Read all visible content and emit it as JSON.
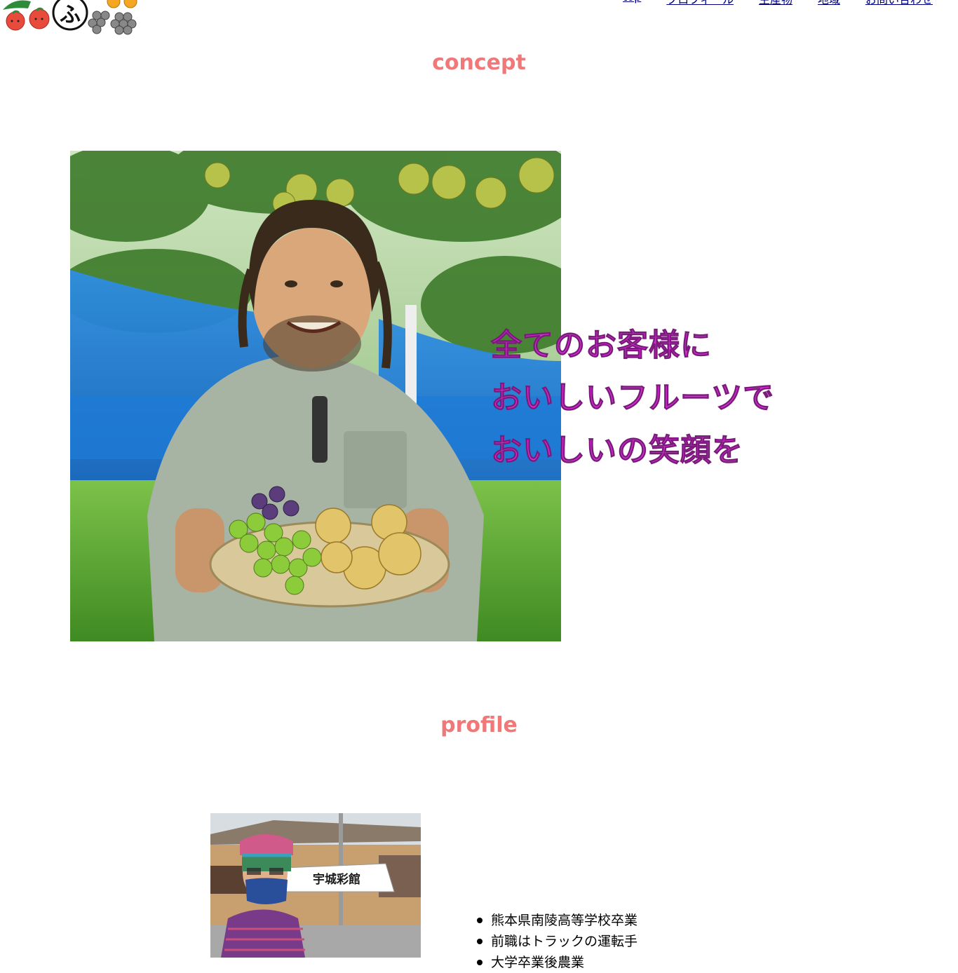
{
  "header": {
    "logo_char": "ふ",
    "nav": [
      "top",
      "プロフィール",
      "生産物",
      "地域",
      "お問い合わせ"
    ]
  },
  "concept": {
    "title": "concept",
    "lines": [
      "全てのお客様に",
      "おいしいフルーツで",
      "おいしいの笑顔を"
    ]
  },
  "profile": {
    "title": "profile",
    "photo_sign": "宇城彩館",
    "items": [
      "熊本県南陵高等学校卒業",
      "前職はトラックの運転手",
      "大学卒業後農業"
    ]
  },
  "colors": {
    "heading": "#f07878",
    "concept_text": "#d92fd9",
    "nav_link": "#000080"
  }
}
